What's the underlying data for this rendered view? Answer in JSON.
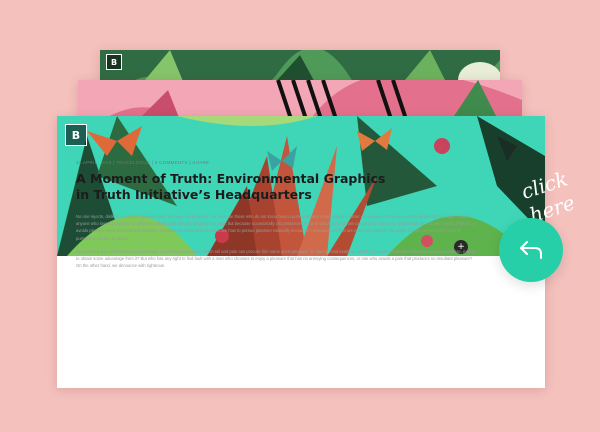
{
  "cards": {
    "front_logo": "B",
    "back_logo": "B"
  },
  "article": {
    "meta": "24 April, 2019 | Tracelogue | 0 Comments | Share",
    "title": "A Moment of Truth: Environmental Graphics in Truth Initiative’s Headquarters",
    "paragraph1": "No one rejects, dislikes, or avoids pleasure itself, because it is pleasure, but because those who do not know how to pursue pleasure rationally encounter consequences that are extremely painful. Nor again is there anyone who loves or pursues or desires to obtain pain of itself, because it is pain, but because occasionally circumstances occur in which toil and pain can procure him some great pleasure. No one rejects, dislikes, or avoids pleasure itself, because it is pleasure, but because those who do not know how to pursue pleasure rationally encounter consequences that are extremely painful. Nor again is there anyone who loves or pursues or desires to obtain.",
    "paragraph2": "Because it is pain, but because occasionally circumstances occur in which toil and pain can procure him some great pleasure. To take a trivial example, which of us ever undertakes laborious physical exercise, except to obtain some advantage from it? But who has any right to find fault with a man who chooses to enjoy a pleasure that has no annoying consequences, or one who avoids a pain that produces no resultant pleasure? On the other hand, we denounce with righteous"
  },
  "overlay": {
    "click_text_line1": "click",
    "click_text_line2": "here",
    "more_button": "+"
  },
  "colors": {
    "background": "#f4c1bd",
    "accent": "#26cfa7",
    "hero_base": "#3fd6b8"
  },
  "icons": {
    "back": "undo-arrow-icon"
  }
}
